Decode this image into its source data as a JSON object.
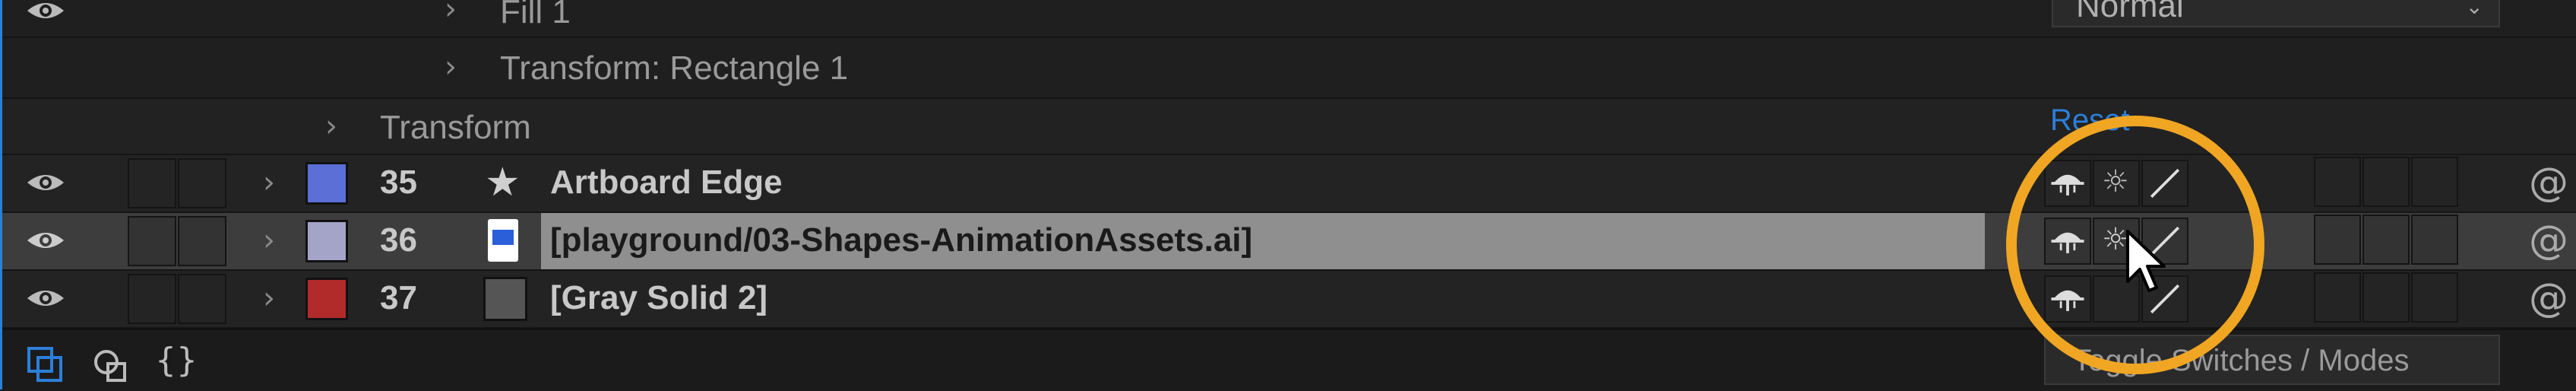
{
  "app": "After Effects timeline",
  "rows": {
    "fill": {
      "label": "Fill 1",
      "blend_mode": "Normal"
    },
    "transform_rect": {
      "label": "Transform: Rectangle 1"
    },
    "transform": {
      "label": "Transform",
      "reset": "Reset"
    }
  },
  "layers": [
    {
      "index": "35",
      "name": "Artboard Edge",
      "label_color": "#5b6fd6",
      "type_icon": "star-icon"
    },
    {
      "index": "36",
      "name": "[playground/03-Shapes-AnimationAssets.ai]",
      "label_color": "#a4a4c8",
      "type_icon": "ai-file-icon"
    },
    {
      "index": "37",
      "name": "[Gray Solid 2]",
      "label_color": "#b12b2b",
      "type_icon": "solid-icon"
    }
  ],
  "footer": {
    "toggle_label": "Toggle Switches / Modes"
  },
  "colors": {
    "highlight_circle": "#f0a623",
    "link_blue": "#2b7fd9"
  }
}
